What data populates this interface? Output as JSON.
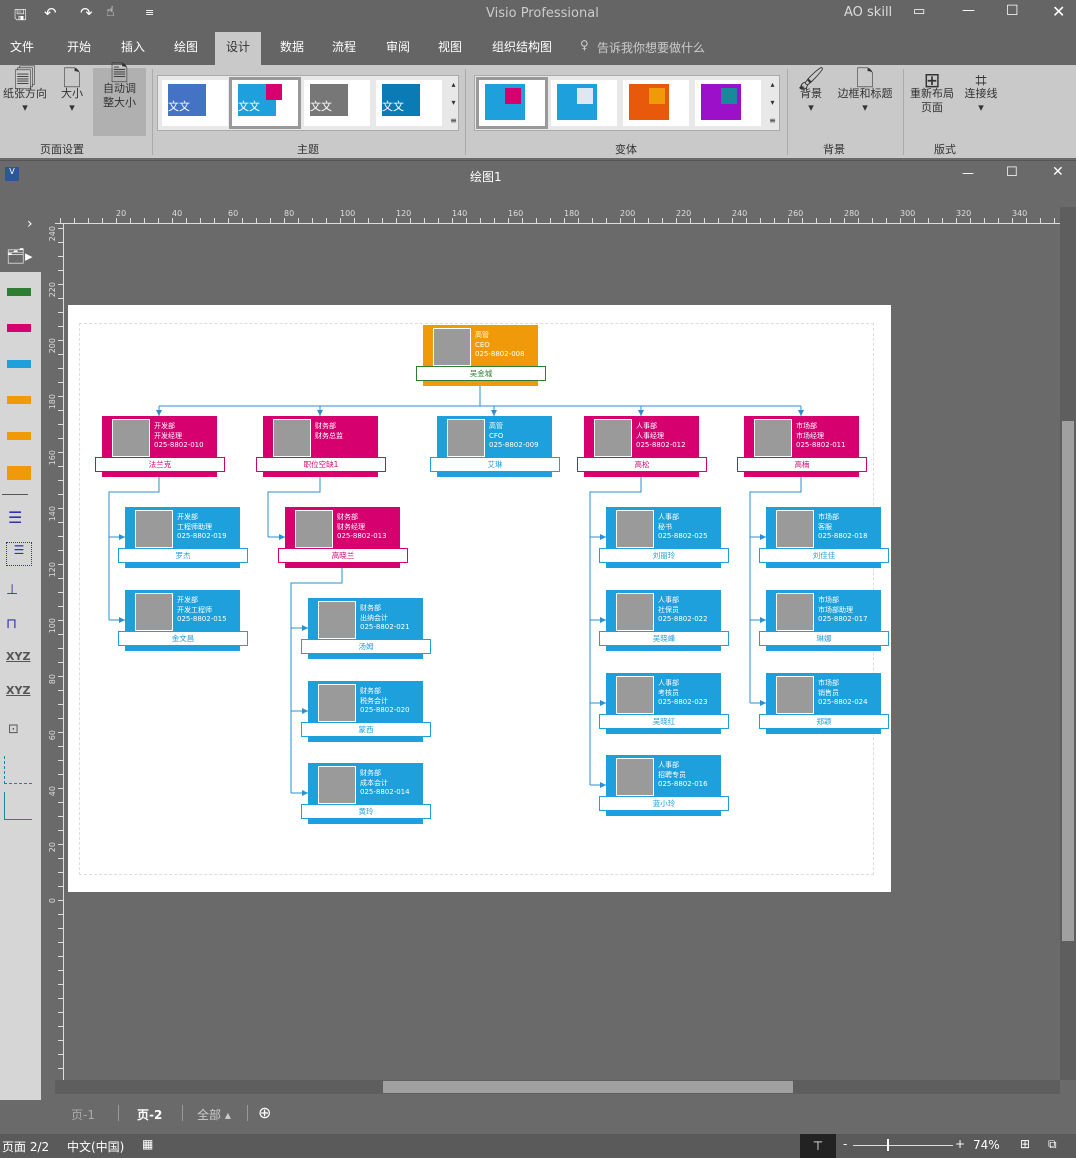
{
  "app": {
    "title": "Visio Professional",
    "user": "AO skill",
    "doc_title": "绘图1"
  },
  "tabs": [
    "文件",
    "开始",
    "插入",
    "绘图",
    "设计",
    "数据",
    "流程",
    "审阅",
    "视图",
    "组织结构图"
  ],
  "tell_me": "告诉我你想要做什么",
  "ribbon": {
    "page_setup": {
      "label": "页面设置",
      "orientation": "纸张方向",
      "size": "大小",
      "autofit": "自动调整大小"
    },
    "themes": {
      "label": "主题",
      "thumb_text": "文文"
    },
    "variants": {
      "label": "变体"
    },
    "background": {
      "label": "背景",
      "bg": "背景",
      "borders": "边框和标题"
    },
    "layout": {
      "label": "版式",
      "relayout": "重新布局页面",
      "connectors": "连接线"
    }
  },
  "org": {
    "nodes": [
      {
        "dept": "高管",
        "title": "CEO",
        "phone": "025-8802-008",
        "name": "吴金城",
        "color": "#f09a0a",
        "band": "#2e7d32"
      },
      {
        "dept": "开发部",
        "title": "开发经理",
        "phone": "025-8802-010",
        "name": "法兰克",
        "color": "#d6006f"
      },
      {
        "dept": "财务部",
        "title": "财务总监",
        "phone": "",
        "name": "职位空缺1",
        "color": "#d6006f"
      },
      {
        "dept": "高管",
        "title": "CFO",
        "phone": "025-8802-009",
        "name": "艾琳",
        "color": "#1ea0dc"
      },
      {
        "dept": "人事部",
        "title": "人事经理",
        "phone": "025-8802-012",
        "name": "高松",
        "color": "#d6006f"
      },
      {
        "dept": "市场部",
        "title": "市场经理",
        "phone": "025-8802-011",
        "name": "高楠",
        "color": "#d6006f"
      },
      {
        "dept": "开发部",
        "title": "工程师助理",
        "phone": "025-8802-019",
        "name": "罗杰",
        "color": "#1ea0dc"
      },
      {
        "dept": "开发部",
        "title": "开发工程师",
        "phone": "025-8802-015",
        "name": "金文昌",
        "color": "#1ea0dc"
      },
      {
        "dept": "财务部",
        "title": "财务经理",
        "phone": "025-8802-013",
        "name": "高晓兰",
        "color": "#d6006f"
      },
      {
        "dept": "财务部",
        "title": "出纳会计",
        "phone": "025-8802-021",
        "name": "汤姆",
        "color": "#1ea0dc"
      },
      {
        "dept": "财务部",
        "title": "税务会计",
        "phone": "025-8802-020",
        "name": "蒙西",
        "color": "#1ea0dc"
      },
      {
        "dept": "财务部",
        "title": "成本会计",
        "phone": "025-8802-014",
        "name": "黄玲",
        "color": "#1ea0dc"
      },
      {
        "dept": "人事部",
        "title": "秘书",
        "phone": "025-8802-025",
        "name": "刘丽玲",
        "color": "#1ea0dc"
      },
      {
        "dept": "人事部",
        "title": "社保员",
        "phone": "025-8802-022",
        "name": "吴晓峰",
        "color": "#1ea0dc"
      },
      {
        "dept": "人事部",
        "title": "考核员",
        "phone": "025-8802-023",
        "name": "吴晓红",
        "color": "#1ea0dc"
      },
      {
        "dept": "人事部",
        "title": "招聘专员",
        "phone": "025-8802-016",
        "name": "蓝小玲",
        "color": "#1ea0dc"
      },
      {
        "dept": "市场部",
        "title": "客服",
        "phone": "025-8802-018",
        "name": "刘佳佳",
        "color": "#1ea0dc"
      },
      {
        "dept": "市场部",
        "title": "市场部助理",
        "phone": "025-8802-017",
        "name": "琳娜",
        "color": "#1ea0dc"
      },
      {
        "dept": "市场部",
        "title": "销售员",
        "phone": "025-8802-024",
        "name": "郑颖",
        "color": "#1ea0dc"
      }
    ]
  },
  "ruler": {
    "h_ticks": [
      "20",
      "40",
      "60",
      "80",
      "100",
      "120",
      "140",
      "160",
      "180",
      "200",
      "220",
      "240",
      "260",
      "280",
      "300",
      "320",
      "340"
    ],
    "v_ticks": [
      "240",
      "220",
      "200",
      "180",
      "160",
      "140",
      "120",
      "100",
      "80",
      "60",
      "40",
      "20",
      "0"
    ]
  },
  "page_tabs": {
    "p1": "页-1",
    "p2": "页-2",
    "all": "全部 ▴"
  },
  "status": {
    "page": "页面 2/2",
    "lang": "中文(中国)",
    "zoom": "74%"
  }
}
